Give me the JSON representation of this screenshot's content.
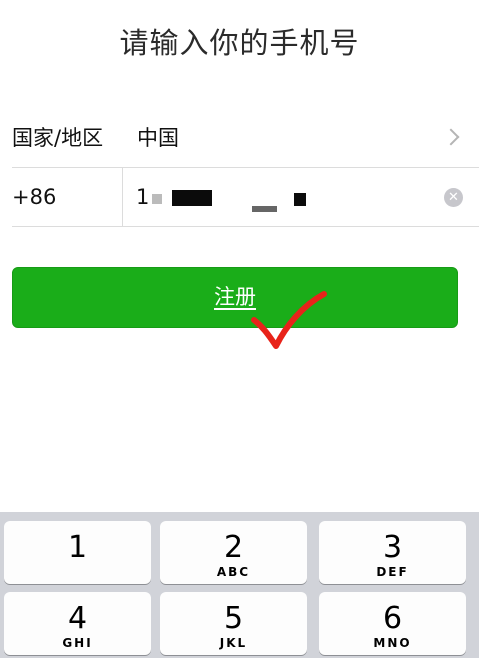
{
  "header": {
    "title": "请输入你的手机号"
  },
  "region": {
    "label": "国家/地区",
    "value": "中国"
  },
  "phone": {
    "country_code": "+86",
    "number_visible": "1"
  },
  "register": {
    "label": "注册"
  },
  "keypad": {
    "keys": [
      {
        "digit": "1",
        "letters": ""
      },
      {
        "digit": "2",
        "letters": "ABC"
      },
      {
        "digit": "3",
        "letters": "DEF"
      },
      {
        "digit": "4",
        "letters": "GHI"
      },
      {
        "digit": "5",
        "letters": "JKL"
      },
      {
        "digit": "6",
        "letters": "MNO"
      }
    ]
  },
  "colors": {
    "accent": "#1aad19",
    "annotation": "#e8231a"
  }
}
